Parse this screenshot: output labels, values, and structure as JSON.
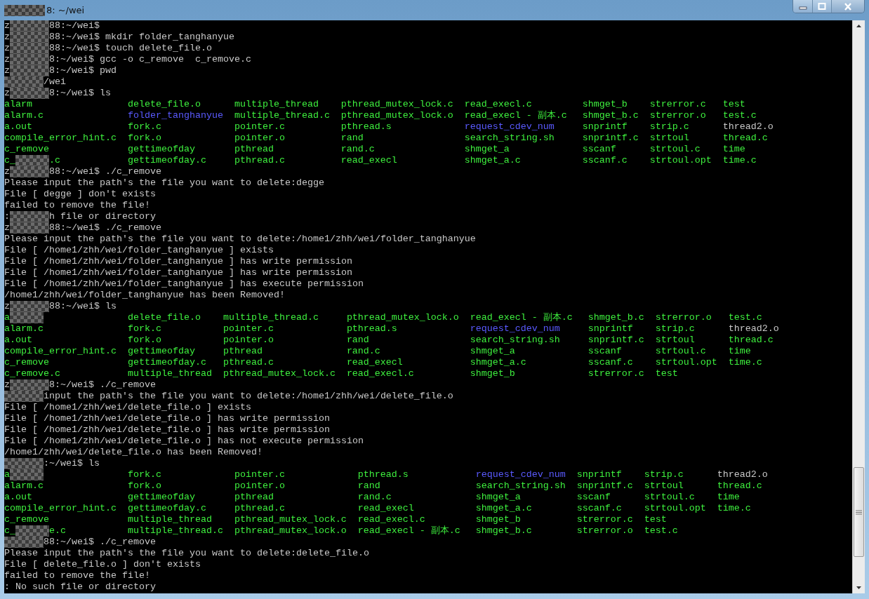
{
  "window": {
    "title": {
      "tail": "8: ~/wei"
    }
  },
  "terminal": {
    "lines": [
      {
        "kind": "masked",
        "lead": "z",
        "tail": "88:~/wei$"
      },
      {
        "kind": "masked",
        "lead": "z",
        "tail": "88:~/wei$ mkdir folder_tanghanyue"
      },
      {
        "kind": "masked",
        "lead": "z",
        "tail": "88:~/wei$ touch delete_file.o"
      },
      {
        "kind": "masked",
        "lead": "z",
        "tail": "8:~/wei$ gcc -o c_remove  c_remove.c"
      },
      {
        "kind": "masked",
        "lead": "z",
        "tail": "8:~/wei$ pwd"
      },
      {
        "kind": "masked",
        "tail": "/wei"
      },
      {
        "kind": "masked",
        "lead": "z",
        "tail": "8:~/wei$ ls"
      },
      {
        "kind": "listing",
        "rows": [
          [
            "alarm",
            "delete_file.o",
            "multiple_thread",
            "pthread_mutex_lock.c",
            "read_execl.c",
            "shmget_b",
            "strerror.c",
            "test"
          ],
          [
            "alarm.c",
            {
              "text": "folder_tanghanyue",
              "color": "#5a5aff"
            },
            "multiple_thread.c",
            "pthread_mutex_lock.o",
            "read_execl - 副本.c",
            "shmget_b.c",
            "strerror.o",
            "test.c"
          ],
          [
            "a.out",
            "fork.c",
            "pointer.c",
            "pthread.s",
            {
              "text": "request_cdev_num",
              "color": "#5a5aff"
            },
            "snprintf",
            "strip.c",
            {
              "text": "thread2.o",
              "color": "#c8c8c8"
            }
          ],
          [
            "compile_error_hint.c",
            "fork.o",
            "pointer.o",
            "rand",
            "search_string.sh",
            "snprintf.c",
            "strtoul",
            "thread.c"
          ],
          [
            "c_remove",
            "gettimeofday",
            "pthread",
            "rand.c",
            "shmget_a",
            "sscanf",
            "strtoul.c",
            "time"
          ],
          [
            {
              "lead": "c_",
              "tail": ".c"
            },
            "gettimeofday.c",
            "pthread.c",
            "read_execl",
            "shmget_a.c",
            "sscanf.c",
            "strtoul.opt",
            "time.c"
          ]
        ]
      },
      {
        "kind": "masked",
        "lead": "z",
        "tail": "88:~/wei$ ./c_remove"
      },
      {
        "kind": "text",
        "text": "Please input the path's the file you want to delete:degge"
      },
      {
        "kind": "text",
        "text": "File [ degge ] don't exists"
      },
      {
        "kind": "text",
        "text": "failed to remove the file!"
      },
      {
        "kind": "masked",
        "lead": ":",
        "tail": "h file or directory"
      },
      {
        "kind": "masked",
        "lead": "z",
        "tail": "88:~/wei$ ./c_remove"
      },
      {
        "kind": "text",
        "text": "Please input the path's the file you want to delete:/home1/zhh/wei/folder_tanghanyue"
      },
      {
        "kind": "text",
        "text": "File [ /home1/zhh/wei/folder_tanghanyue ] exists"
      },
      {
        "kind": "text",
        "text": "File [ /home1/zhh/wei/folder_tanghanyue ] has write permission"
      },
      {
        "kind": "text",
        "text": "File [ /home1/zhh/wei/folder_tanghanyue ] has write permission"
      },
      {
        "kind": "text",
        "text": "File [ /home1/zhh/wei/folder_tanghanyue ] has execute permission"
      },
      {
        "kind": "text",
        "text": "/home1/zhh/wei/folder_tanghanyue has been Removed!"
      },
      {
        "kind": "masked",
        "lead": "z",
        "tail": "88:~/wei$ ls"
      },
      {
        "kind": "listing",
        "rows": [
          [
            {
              "lead": "a"
            },
            "delete_file.o",
            "multiple_thread.c",
            "pthread_mutex_lock.o",
            "read_execl - 副本.c",
            "shmget_b.c",
            "strerror.o",
            "test.c"
          ],
          [
            "alarm.c",
            "fork.c",
            "pointer.c",
            "pthread.s",
            {
              "text": "request_cdev_num",
              "color": "#5a5aff"
            },
            "snprintf",
            "strip.c",
            {
              "text": "thread2.o",
              "color": "#c8c8c8"
            }
          ],
          [
            "a.out",
            "fork.o",
            "pointer.o",
            "rand",
            "search_string.sh",
            "snprintf.c",
            "strtoul",
            "thread.c"
          ],
          [
            "compile_error_hint.c",
            "gettimeofday",
            "pthread",
            "rand.c",
            "shmget_a",
            "sscanf",
            "strtoul.c",
            "time"
          ],
          [
            "c_remove",
            "gettimeofday.c",
            "pthread.c",
            "read_execl",
            "shmget_a.c",
            "sscanf.c",
            "strtoul.opt",
            "time.c"
          ],
          [
            "c_remove.c",
            "multiple_thread",
            "pthread_mutex_lock.c",
            "read_execl.c",
            "shmget_b",
            "strerror.c",
            "test"
          ]
        ]
      },
      {
        "kind": "masked",
        "lead": "z",
        "tail": "8:~/wei$ ./c_remove"
      },
      {
        "kind": "masked",
        "tail": "input the path's the file you want to delete:/home1/zhh/wei/delete_file.o"
      },
      {
        "kind": "text",
        "text": "File [ /home1/zhh/wei/delete_file.o ] exists"
      },
      {
        "kind": "text",
        "text": "File [ /home1/zhh/wei/delete_file.o ] has write permission"
      },
      {
        "kind": "text",
        "text": "File [ /home1/zhh/wei/delete_file.o ] has write permission"
      },
      {
        "kind": "text",
        "text": "File [ /home1/zhh/wei/delete_file.o ] has not execute permission"
      },
      {
        "kind": "text",
        "text": "/home1/zhh/wei/delete_file.o has been Removed!"
      },
      {
        "kind": "masked",
        "tail": ":~/wei$ ls"
      },
      {
        "kind": "listing",
        "rows": [
          [
            {
              "lead": "a"
            },
            "fork.c",
            "pointer.c",
            "pthread.s",
            {
              "text": "request_cdev_num",
              "color": "#5a5aff"
            },
            "snprintf",
            "strip.c",
            {
              "text": "thread2.o",
              "color": "#c8c8c8"
            }
          ],
          [
            "alarm.c",
            "fork.o",
            "pointer.o",
            "rand",
            "search_string.sh",
            "snprintf.c",
            "strtoul",
            "thread.c"
          ],
          [
            "a.out",
            "gettimeofday",
            "pthread",
            "rand.c",
            "shmget_a",
            "sscanf",
            "strtoul.c",
            "time"
          ],
          [
            "compile_error_hint.c",
            "gettimeofday.c",
            "pthread.c",
            "read_execl",
            "shmget_a.c",
            "sscanf.c",
            "strtoul.opt",
            "time.c"
          ],
          [
            "c_remove",
            "multiple_thread",
            "pthread_mutex_lock.c",
            "read_execl.c",
            "shmget_b",
            "strerror.c",
            "test"
          ],
          [
            {
              "lead": "c_",
              "tail": "e.c"
            },
            "multiple_thread.c",
            "pthread_mutex_lock.o",
            "read_execl - 副本.c",
            "shmget_b.c",
            "strerror.o",
            "test.c"
          ]
        ]
      },
      {
        "kind": "masked",
        "tail": "88:~/wei$ ./c_remove"
      },
      {
        "kind": "text",
        "text": "Please input the path's the file you want to delete:delete_file.o"
      },
      {
        "kind": "text",
        "text": "File [ delete_file.o ] don't exists"
      },
      {
        "kind": "text",
        "text": "failed to remove the file!"
      },
      {
        "kind": "text",
        "text": ": No such file or directory"
      }
    ]
  }
}
